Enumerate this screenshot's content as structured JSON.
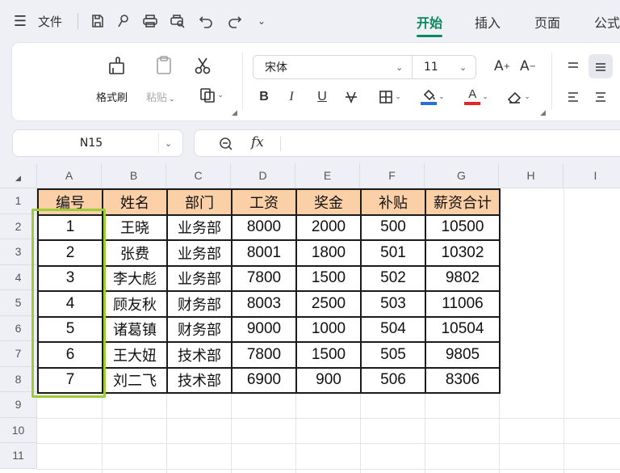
{
  "toolbar": {
    "file_label": "文件",
    "icons": [
      "menu-icon",
      "save-icon",
      "format-painter-small-icon",
      "print-icon",
      "print-preview-icon",
      "undo-icon",
      "redo-icon",
      "more-icon"
    ]
  },
  "tabs": [
    {
      "label": "开始",
      "active": true
    },
    {
      "label": "插入",
      "active": false
    },
    {
      "label": "页面",
      "active": false
    },
    {
      "label": "公式",
      "active": false
    }
  ],
  "ribbon": {
    "format_painter": "格式刷",
    "paste": "粘贴",
    "font_name": "宋体",
    "font_size": "11",
    "bold": "B",
    "italic": "I",
    "underline": "U",
    "accent_colors": {
      "fill": "#2b6fd6",
      "font": "#e8242b"
    }
  },
  "namebox": {
    "value": "N15"
  },
  "formula": {
    "fx": "fx",
    "value": ""
  },
  "sheet": {
    "columns": [
      "A",
      "B",
      "C",
      "D",
      "E",
      "F",
      "G",
      "H",
      "I"
    ],
    "rows": [
      "1",
      "2",
      "3",
      "4",
      "5",
      "6",
      "7",
      "8",
      "9",
      "10",
      "11"
    ],
    "header_fill": "#fbd0a6",
    "selection_color": "#9ccc3a",
    "headers": [
      "编号",
      "姓名",
      "部门",
      "工资",
      "奖金",
      "补贴",
      "薪资合计"
    ],
    "data": [
      [
        "1",
        "王晓",
        "业务部",
        "8000",
        "2000",
        "500",
        "10500"
      ],
      [
        "2",
        "张费",
        "业务部",
        "8001",
        "1800",
        "501",
        "10302"
      ],
      [
        "3",
        "李大彪",
        "业务部",
        "7800",
        "1500",
        "502",
        "9802"
      ],
      [
        "4",
        "顾友秋",
        "财务部",
        "8003",
        "2500",
        "503",
        "11006"
      ],
      [
        "5",
        "诸葛镇",
        "财务部",
        "9000",
        "1000",
        "504",
        "10504"
      ],
      [
        "6",
        "王大妞",
        "技术部",
        "7800",
        "1500",
        "505",
        "9805"
      ],
      [
        "7",
        "刘二飞",
        "技术部",
        "6900",
        "900",
        "506",
        "8306"
      ]
    ]
  }
}
